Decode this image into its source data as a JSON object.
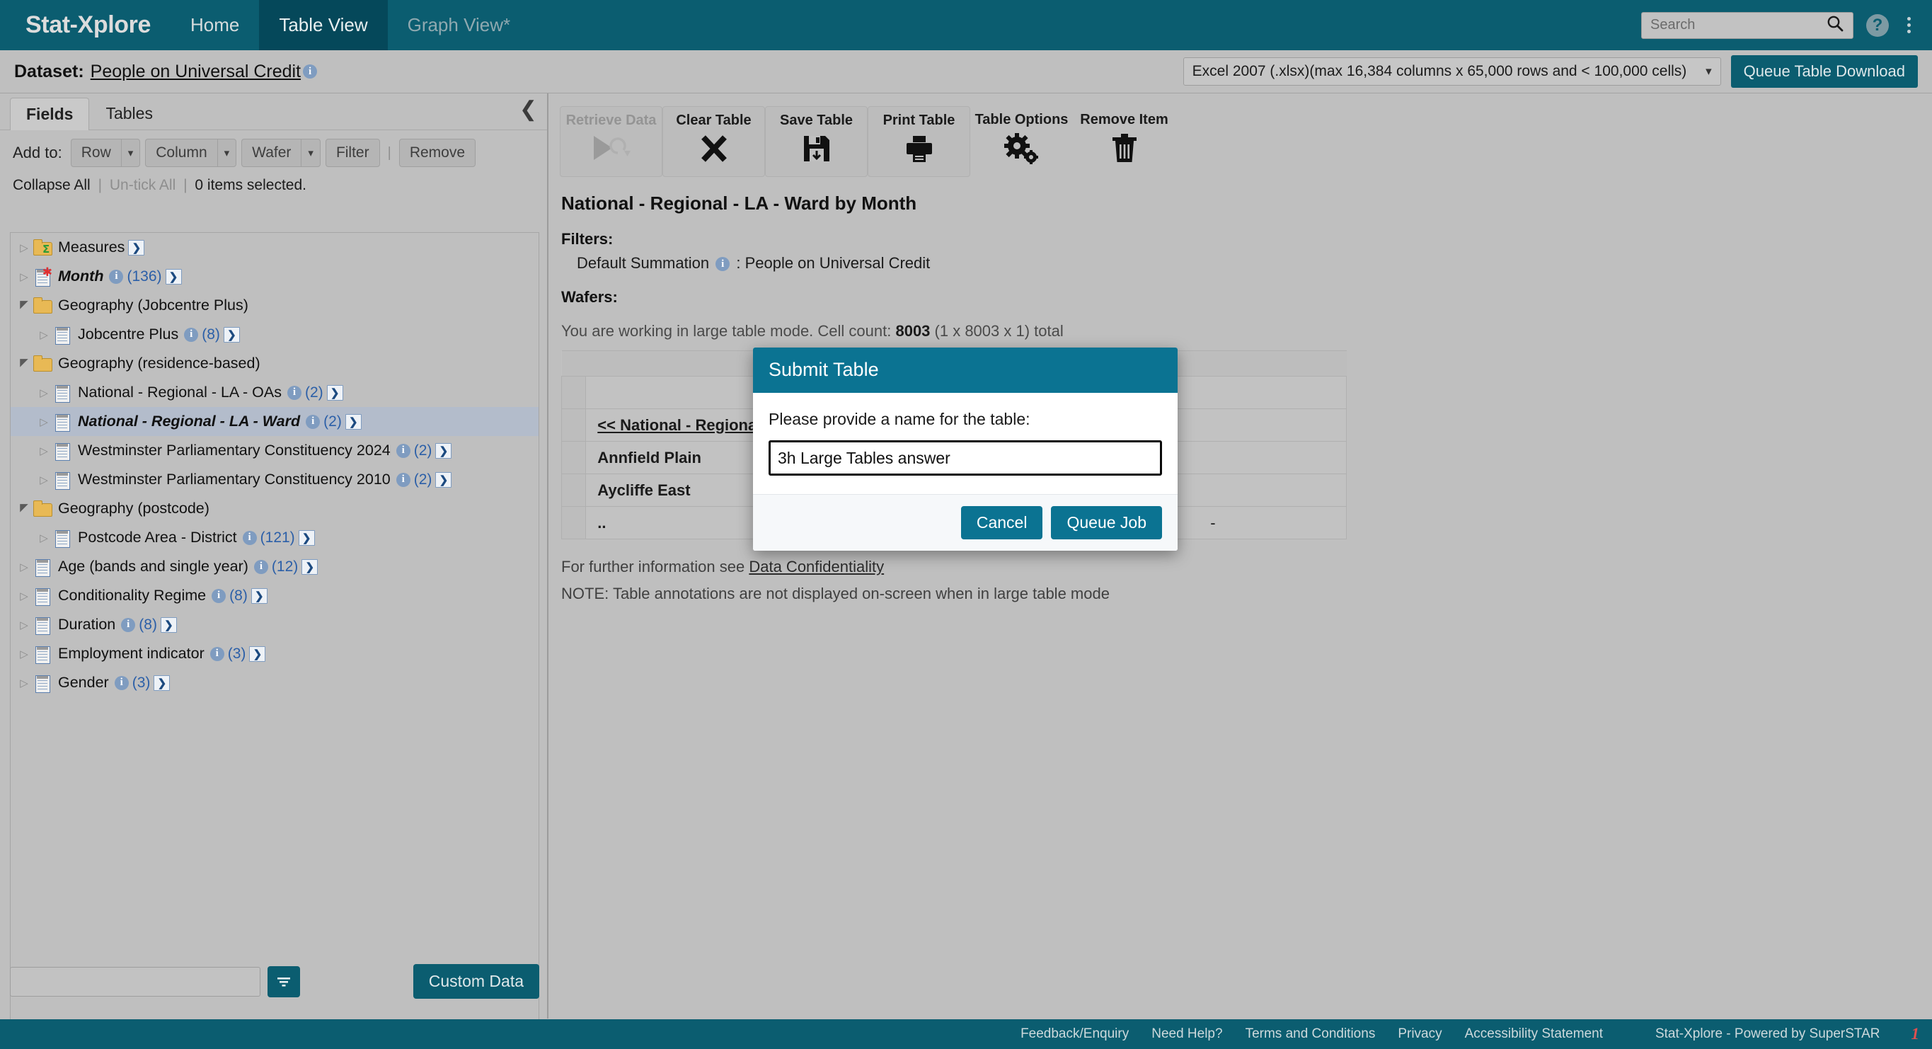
{
  "header": {
    "brand": "Stat-Xplore",
    "tabs": [
      {
        "label": "Home",
        "state": "normal"
      },
      {
        "label": "Table View",
        "state": "active"
      },
      {
        "label": "Graph View*",
        "state": "dim"
      }
    ],
    "search_placeholder": "Search",
    "search_value": "",
    "search_icon": "search-icon",
    "help_icon": "question-mark-icon",
    "menu_icon": "kebab-menu-icon"
  },
  "dataset_bar": {
    "label": "Dataset:",
    "name": "People on Universal Credit",
    "info_icon": "info-icon",
    "format_select_value": "Excel 2007 (.xlsx)(max 16,384 columns x 65,000 rows and < 100,000 cells)",
    "queue_download_label": "Queue Table Download"
  },
  "left_panel": {
    "tabs": [
      {
        "label": "Fields",
        "active": true
      },
      {
        "label": "Tables",
        "active": false
      }
    ],
    "collapse_icon": "chevron-left-icon",
    "add_to_label": "Add to:",
    "add_buttons": [
      "Row",
      "Column",
      "Wafer"
    ],
    "filter_label": "Filter",
    "remove_label": "Remove",
    "collapse_all": "Collapse All",
    "untick_all": "Un-tick All",
    "items_selected": "0 items selected.",
    "search_value": "",
    "filter_icon": "filter-icon",
    "custom_data_label": "Custom Data",
    "tree": [
      {
        "label": "Measures",
        "icon": "folder-sigma-icon",
        "indent": 1,
        "expander": "collapsed",
        "count": null,
        "go": true,
        "italic": false,
        "info": false,
        "selected": false
      },
      {
        "label": "Month",
        "icon": "field-new-icon",
        "indent": 1,
        "expander": "collapsed",
        "count": "(136)",
        "go": true,
        "italic": true,
        "info": true,
        "selected": false
      },
      {
        "label": "Geography (Jobcentre Plus)",
        "icon": "folder-icon",
        "indent": 1,
        "expander": "expanded",
        "count": null,
        "go": false,
        "italic": false,
        "info": false,
        "selected": false
      },
      {
        "label": "Jobcentre Plus",
        "icon": "field-icon",
        "indent": 2,
        "expander": "collapsed",
        "count": "(8)",
        "go": true,
        "italic": false,
        "info": true,
        "selected": false
      },
      {
        "label": "Geography (residence-based)",
        "icon": "folder-icon",
        "indent": 1,
        "expander": "expanded",
        "count": null,
        "go": false,
        "italic": false,
        "info": false,
        "selected": false
      },
      {
        "label": "National - Regional - LA - OAs",
        "icon": "field-icon",
        "indent": 2,
        "expander": "collapsed",
        "count": "(2)",
        "go": true,
        "italic": false,
        "info": true,
        "selected": false
      },
      {
        "label": "National - Regional - LA - Ward",
        "icon": "field-icon",
        "indent": 2,
        "expander": "collapsed",
        "count": "(2)",
        "go": true,
        "italic": true,
        "info": true,
        "selected": true
      },
      {
        "label": "Westminster Parliamentary Constituency 2024",
        "icon": "field-icon",
        "indent": 2,
        "expander": "collapsed",
        "count": "(2)",
        "go": true,
        "italic": false,
        "info": true,
        "selected": false
      },
      {
        "label": "Westminster Parliamentary Constituency 2010",
        "icon": "field-icon",
        "indent": 2,
        "expander": "collapsed",
        "count": "(2)",
        "go": true,
        "italic": false,
        "info": true,
        "selected": false
      },
      {
        "label": "Geography (postcode)",
        "icon": "folder-icon",
        "indent": 1,
        "expander": "expanded",
        "count": null,
        "go": false,
        "italic": false,
        "info": false,
        "selected": false
      },
      {
        "label": "Postcode Area - District",
        "icon": "field-icon",
        "indent": 2,
        "expander": "collapsed",
        "count": "(121)",
        "go": true,
        "italic": false,
        "info": true,
        "selected": false
      },
      {
        "label": "Age (bands and single year)",
        "icon": "field-icon",
        "indent": 1,
        "expander": "collapsed",
        "count": "(12)",
        "go": true,
        "italic": false,
        "info": true,
        "selected": false
      },
      {
        "label": "Conditionality Regime",
        "icon": "field-icon",
        "indent": 1,
        "expander": "collapsed",
        "count": "(8)",
        "go": true,
        "italic": false,
        "info": true,
        "selected": false
      },
      {
        "label": "Duration",
        "icon": "field-icon",
        "indent": 1,
        "expander": "collapsed",
        "count": "(8)",
        "go": true,
        "italic": false,
        "info": true,
        "selected": false
      },
      {
        "label": "Employment indicator",
        "icon": "field-icon",
        "indent": 1,
        "expander": "collapsed",
        "count": "(3)",
        "go": true,
        "italic": false,
        "info": true,
        "selected": false
      },
      {
        "label": "Gender",
        "icon": "field-icon",
        "indent": 1,
        "expander": "collapsed",
        "count": "(3)",
        "go": true,
        "italic": false,
        "info": true,
        "selected": false
      }
    ]
  },
  "toolbar": [
    {
      "label": "Retrieve Data",
      "icon": "play-refresh-icon",
      "disabled": true,
      "boxed": true
    },
    {
      "label": "Clear Table",
      "icon": "cross-icon",
      "disabled": false,
      "boxed": true
    },
    {
      "label": "Save Table",
      "icon": "floppy-disk-icon",
      "disabled": false,
      "boxed": true
    },
    {
      "label": "Print Table",
      "icon": "printer-icon",
      "disabled": false,
      "boxed": true
    },
    {
      "label": "Table Options",
      "icon": "gears-icon",
      "disabled": false,
      "boxed": false
    },
    {
      "label": "Remove Item",
      "icon": "trash-icon",
      "disabled": false,
      "boxed": false
    }
  ],
  "main": {
    "table_title": "National - Regional - LA - Ward by Month",
    "filters_heading": "Filters:",
    "filter_line_label": "Default Summation",
    "filter_line_value": ": People on Universal Credit",
    "wafers_heading": "Wafers:",
    "large_mode_prefix": "You are working in large table mode. Cell count: ",
    "large_mode_count": "8003",
    "large_mode_suffix": " (1 x 8003 x 1) total",
    "further_info_prefix": "For further information see ",
    "further_info_link": "Data Confidentiality",
    "note": "NOTE: Table annotations are not displayed on-screen when in large table mode"
  },
  "data_table": {
    "row_header_link": "<< National - Regional",
    "rows": [
      {
        "label": "Annfield Plain",
        "value": ""
      },
      {
        "label": "Aycliffe East",
        "value": ""
      },
      {
        "label": "..",
        "value": "-"
      }
    ]
  },
  "modal": {
    "title": "Submit Table",
    "prompt": "Please provide a name for the table:",
    "input_value": "3h Large Tables answer",
    "cancel_label": "Cancel",
    "confirm_label": "Queue Job"
  },
  "footer": {
    "links": [
      "Feedback/Enquiry",
      "Need Help?",
      "Terms and Conditions",
      "Privacy",
      "Accessibility Statement"
    ],
    "note": "Stat-Xplore - Powered by SuperSTAR",
    "logo": "1"
  },
  "colors": {
    "brand_teal": "#0b5d70",
    "active_tab_teal": "#05485a",
    "modal_teal": "#0b7392",
    "page_gray": "#bfbfbf",
    "count_blue": "#2b5fa8",
    "selected_row": "#b3bccb"
  }
}
